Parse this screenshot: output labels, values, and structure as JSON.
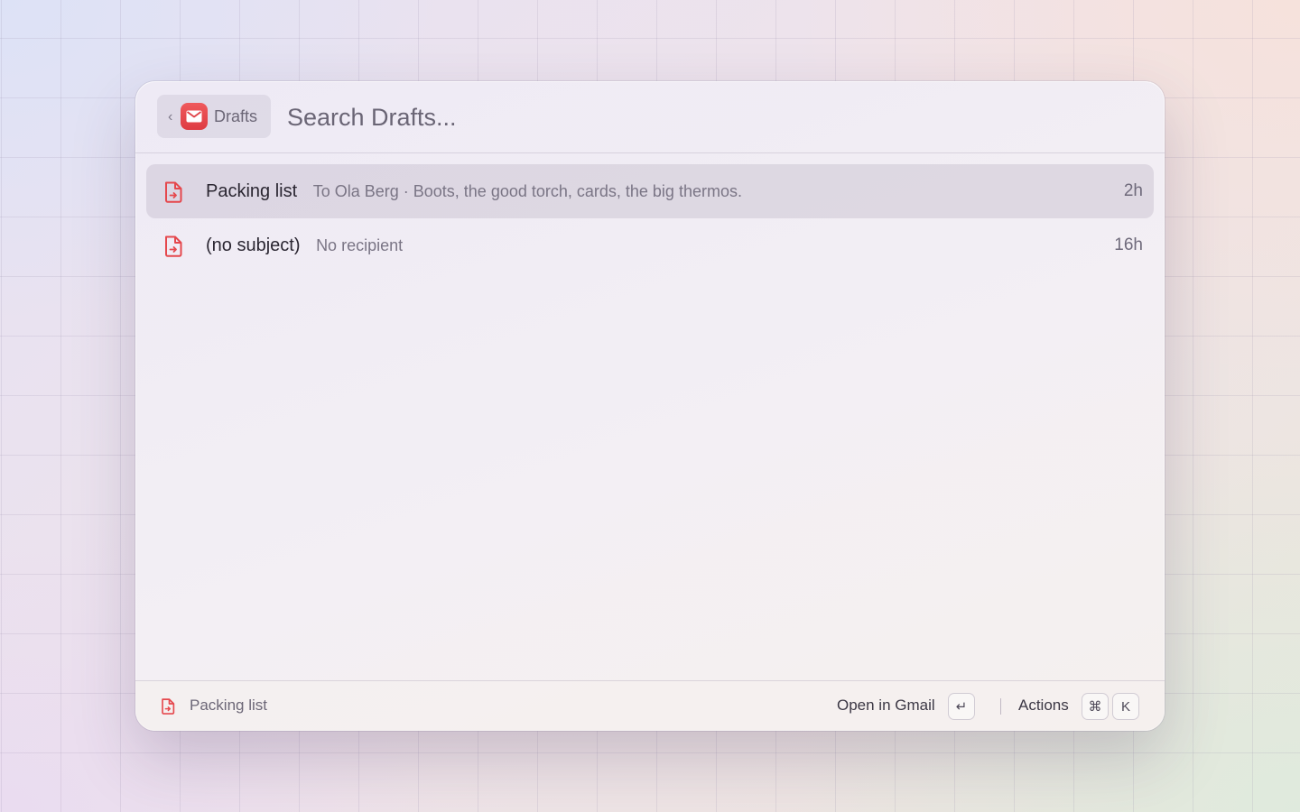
{
  "header": {
    "back_label": "Drafts",
    "search_placeholder": "Search Drafts..."
  },
  "drafts": [
    {
      "title": "Packing list",
      "subtitle": "To Ola Berg · Boots, the good torch, cards, the big thermos.",
      "time": "2h",
      "selected": true
    },
    {
      "title": "(no subject)",
      "subtitle": "No recipient",
      "time": "16h",
      "selected": false
    }
  ],
  "footer": {
    "selected_title": "Packing list",
    "primary_action": "Open in Gmail",
    "primary_shortcut": "↵",
    "actions_label": "Actions",
    "actions_shortcut": [
      "⌘",
      "K"
    ]
  },
  "icons": {
    "app": "gmail-icon",
    "draft": "draft-document-icon",
    "back": "chevron-left-icon"
  },
  "colors": {
    "accent": "#E5484D"
  }
}
